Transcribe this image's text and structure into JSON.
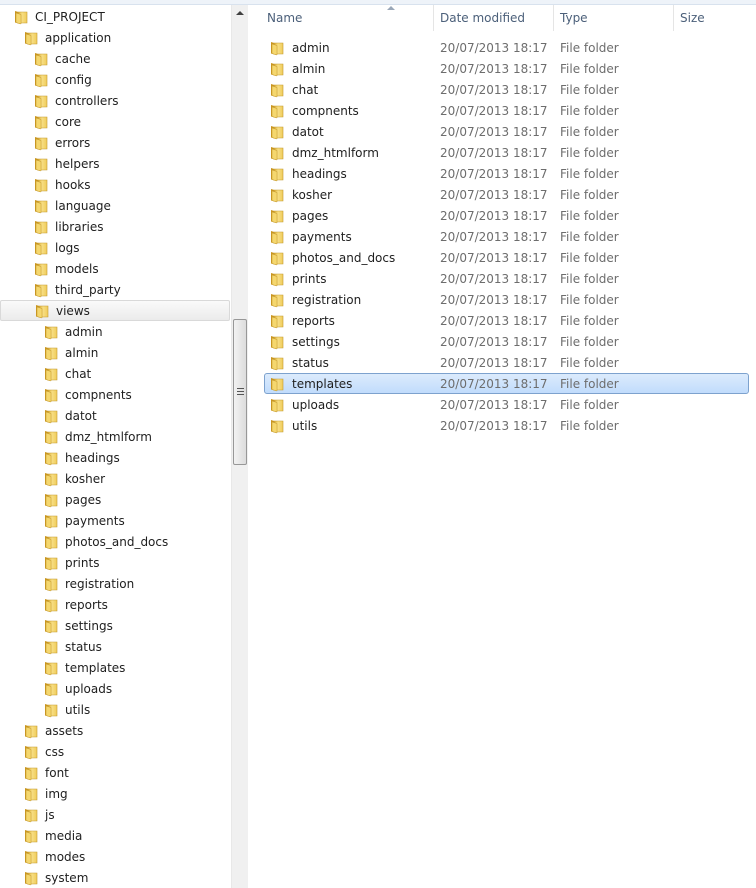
{
  "nav": {
    "root": "CI_PROJECT",
    "application": "application",
    "application_children": [
      "cache",
      "config",
      "controllers",
      "core",
      "errors",
      "helpers",
      "hooks",
      "language",
      "libraries",
      "logs",
      "models",
      "third_party"
    ],
    "views": "views",
    "views_children": [
      "admin",
      "almin",
      "chat",
      "compnents",
      "datot",
      "dmz_htmlform",
      "headings",
      "kosher",
      "pages",
      "payments",
      "photos_and_docs",
      "prints",
      "registration",
      "reports",
      "settings",
      "status",
      "templates",
      "uploads",
      "utils"
    ],
    "root_siblings": [
      "assets",
      "css",
      "font",
      "img",
      "js",
      "media",
      "modes",
      "system"
    ],
    "selected": "views"
  },
  "columns": {
    "name": "Name",
    "date": "Date modified",
    "type": "Type",
    "size": "Size"
  },
  "files": [
    {
      "name": "admin",
      "date": "20/07/2013 18:17",
      "type": "File folder"
    },
    {
      "name": "almin",
      "date": "20/07/2013 18:17",
      "type": "File folder"
    },
    {
      "name": "chat",
      "date": "20/07/2013 18:17",
      "type": "File folder"
    },
    {
      "name": "compnents",
      "date": "20/07/2013 18:17",
      "type": "File folder"
    },
    {
      "name": "datot",
      "date": "20/07/2013 18:17",
      "type": "File folder"
    },
    {
      "name": "dmz_htmlform",
      "date": "20/07/2013 18:17",
      "type": "File folder"
    },
    {
      "name": "headings",
      "date": "20/07/2013 18:17",
      "type": "File folder"
    },
    {
      "name": "kosher",
      "date": "20/07/2013 18:17",
      "type": "File folder"
    },
    {
      "name": "pages",
      "date": "20/07/2013 18:17",
      "type": "File folder"
    },
    {
      "name": "payments",
      "date": "20/07/2013 18:17",
      "type": "File folder"
    },
    {
      "name": "photos_and_docs",
      "date": "20/07/2013 18:17",
      "type": "File folder"
    },
    {
      "name": "prints",
      "date": "20/07/2013 18:17",
      "type": "File folder"
    },
    {
      "name": "registration",
      "date": "20/07/2013 18:17",
      "type": "File folder"
    },
    {
      "name": "reports",
      "date": "20/07/2013 18:17",
      "type": "File folder"
    },
    {
      "name": "settings",
      "date": "20/07/2013 18:17",
      "type": "File folder"
    },
    {
      "name": "status",
      "date": "20/07/2013 18:17",
      "type": "File folder"
    },
    {
      "name": "templates",
      "date": "20/07/2013 18:17",
      "type": "File folder"
    },
    {
      "name": "uploads",
      "date": "20/07/2013 18:17",
      "type": "File folder"
    },
    {
      "name": "utils",
      "date": "20/07/2013 18:17",
      "type": "File folder"
    }
  ],
  "selected_file": "templates",
  "icons": {
    "folder": "folder-icon",
    "sort": "sort-ascending-icon",
    "scroll_up": "scroll-up-arrow-icon",
    "grip": "scrollbar-grip-icon"
  },
  "colors": {
    "header_text": "#4c607a",
    "secondary_text": "#6d6d6d",
    "selection_border": "#7da2ce",
    "selection_fill": "#cce4fc",
    "folder_yellow": "#f2cf5b"
  }
}
